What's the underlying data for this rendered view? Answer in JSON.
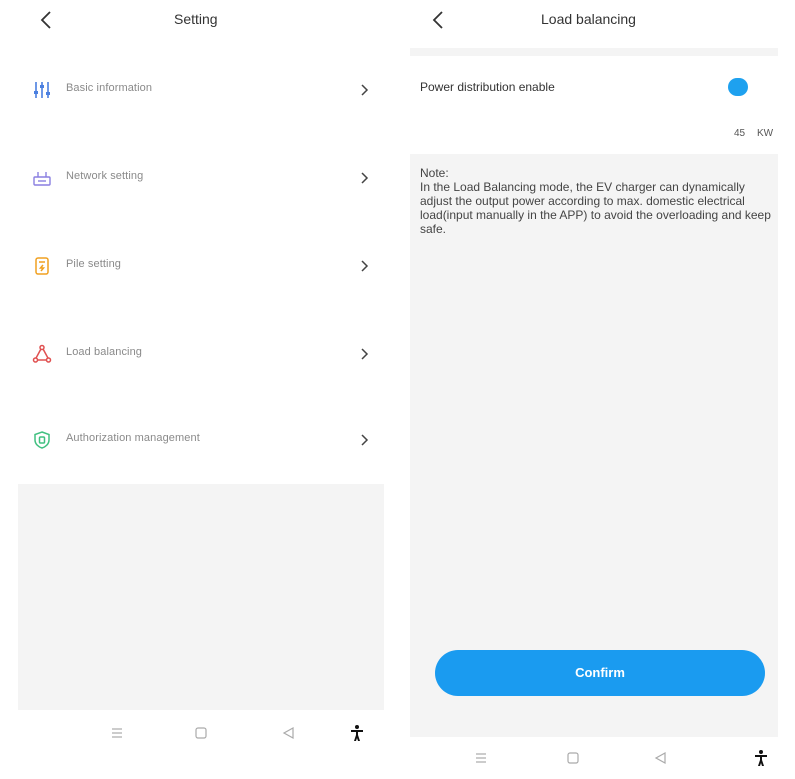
{
  "left": {
    "header": {
      "title": "Setting"
    },
    "menu": [
      {
        "label": "Basic information",
        "icon": "sliders-icon",
        "color": "#4a7fe0"
      },
      {
        "label": "Network setting",
        "icon": "router-icon",
        "color": "#8a7fe0"
      },
      {
        "label": "Pile setting",
        "icon": "charging-pile-icon",
        "color": "#f0a020"
      },
      {
        "label": "Load balancing",
        "icon": "triangle-nodes-icon",
        "color": "#e05050"
      },
      {
        "label": "Authorization management",
        "icon": "shield-icon",
        "color": "#40c080"
      }
    ]
  },
  "right": {
    "header": {
      "title": "Load balancing"
    },
    "power_distribution": {
      "label": "Power distribution enable",
      "enabled": true,
      "accent": "#1ea1ef"
    },
    "power_value": {
      "value": "45",
      "unit": "KW"
    },
    "note": "Note:\nIn the Load Balancing mode, the EV charger can dynamically adjust the output power according to max. domestic electrical load(input manually in the APP) to avoid the overloading and keep safe.",
    "confirm_label": "Confirm",
    "confirm_color": "#1a9bf0"
  },
  "navbar": {
    "icons": [
      "menu-icon",
      "home-icon",
      "back-triangle-icon",
      "accessibility-icon"
    ]
  }
}
